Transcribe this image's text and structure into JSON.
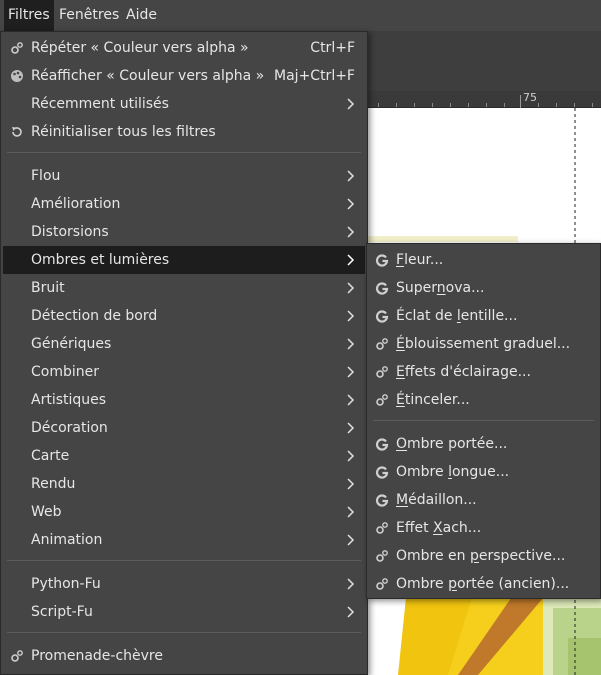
{
  "menubar": {
    "items": [
      "Filtres",
      "Fenêtres",
      "Aide"
    ]
  },
  "ruler": {
    "label": "75"
  },
  "filters_menu": {
    "items": [
      {
        "label": "Répéter « Couleur vers alpha »",
        "accel": "Ctrl+F",
        "icon": "gear-icon"
      },
      {
        "label": "Réafficher « Couleur vers alpha »",
        "accel": "Maj+Ctrl+F",
        "icon": "palette-icon"
      },
      {
        "label": "Récemment utilisés",
        "submenu": true
      },
      {
        "label": "Réinitialiser tous les filtres",
        "icon": "reset-icon"
      },
      {
        "label": "Flou",
        "submenu": true
      },
      {
        "label": "Amélioration",
        "submenu": true
      },
      {
        "label": "Distorsions",
        "submenu": true
      },
      {
        "label": "Ombres et lumières",
        "submenu": true,
        "highlighted": true
      },
      {
        "label": "Bruit",
        "submenu": true
      },
      {
        "label": "Détection de bord",
        "submenu": true
      },
      {
        "label": "Génériques",
        "submenu": true
      },
      {
        "label": "Combiner",
        "submenu": true
      },
      {
        "label": "Artistiques",
        "submenu": true
      },
      {
        "label": "Décoration",
        "submenu": true
      },
      {
        "label": "Carte",
        "submenu": true
      },
      {
        "label": "Rendu",
        "submenu": true
      },
      {
        "label": "Web",
        "submenu": true
      },
      {
        "label": "Animation",
        "submenu": true
      },
      {
        "label": "Python-Fu",
        "submenu": true
      },
      {
        "label": "Script-Fu",
        "submenu": true
      },
      {
        "label": "Promenade-chèvre",
        "icon": "gear-icon"
      }
    ]
  },
  "shadows_menu": {
    "items": [
      {
        "pre": "",
        "u": "F",
        "post": "leur...",
        "icon": "gegl-icon"
      },
      {
        "pre": "Super",
        "u": "n",
        "post": "ova...",
        "icon": "gegl-icon"
      },
      {
        "pre": "Éclat de ",
        "u": "l",
        "post": "entille...",
        "icon": "gegl-icon"
      },
      {
        "pre": "",
        "u": "É",
        "post": "blouissement graduel...",
        "icon": "gear-icon"
      },
      {
        "pre": "",
        "u": "E",
        "post": "ffets d'éclairage...",
        "icon": "gear-icon"
      },
      {
        "pre": "",
        "u": "É",
        "post": "tinceler...",
        "icon": "gear-icon"
      },
      {
        "pre": "",
        "u": "O",
        "post": "mbre portée...",
        "icon": "gegl-icon"
      },
      {
        "pre": "Ombre ",
        "u": "l",
        "post": "ongue...",
        "icon": "gegl-icon"
      },
      {
        "pre": "",
        "u": "M",
        "post": "édaillon...",
        "icon": "gegl-icon"
      },
      {
        "pre": "Effet ",
        "u": "X",
        "post": "ach...",
        "icon": "gear-icon"
      },
      {
        "pre": "Ombre en ",
        "u": "p",
        "post": "erspective...",
        "icon": "gear-icon"
      },
      {
        "pre": "Ombre ",
        "u": "p",
        "post": "ortée (ancien)...",
        "icon": "gear-icon"
      }
    ]
  },
  "colors": {
    "menu_bg": "#454545",
    "highlight": "#1d1d1d",
    "text": "#e6e6e6",
    "canvas_yellow": "#f1c40f",
    "canvas_brown": "#c0792a"
  }
}
